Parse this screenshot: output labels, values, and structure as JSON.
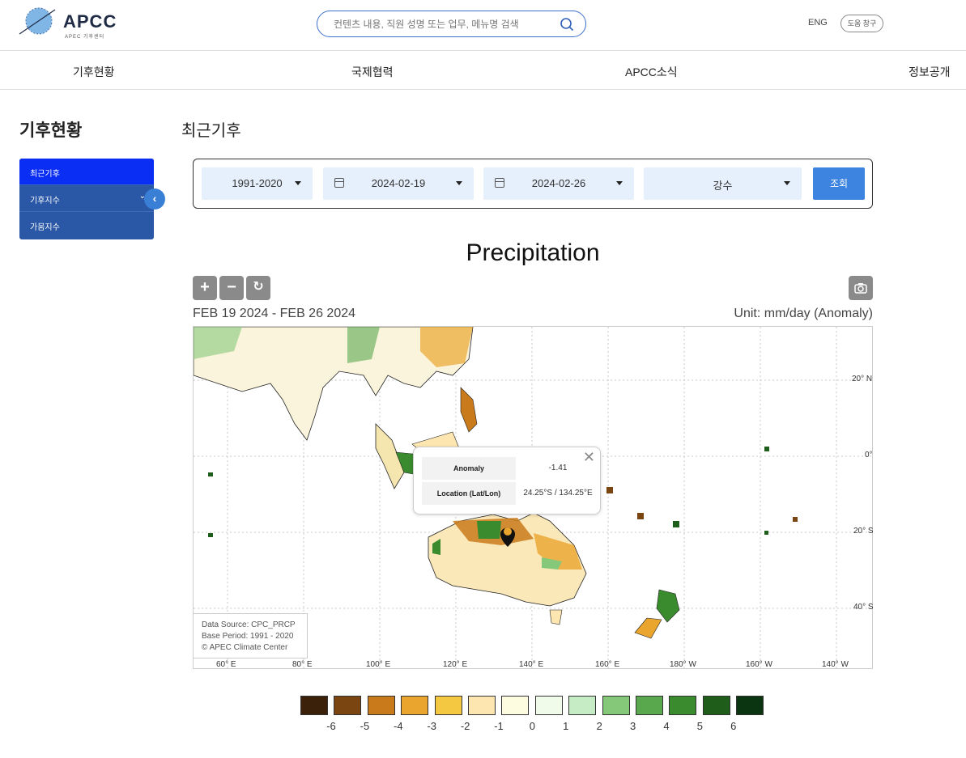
{
  "header": {
    "logo_text": "APCC",
    "logo_sub": "APEC 기후센터",
    "search_placeholder": "컨텐츠 내용, 직원 성명 또는 업무, 메뉴명 검색",
    "lang": "ENG",
    "help": "도움 창구"
  },
  "nav": [
    "기후현황",
    "국제협력",
    "APCC소식",
    "정보공개"
  ],
  "sidebar": {
    "title": "기후현황",
    "items": [
      "최근기후",
      "기후지수",
      "가뭄지수"
    ]
  },
  "page_title": "최근기후",
  "filters": {
    "period": "1991-2020",
    "start_date": "2024-02-19",
    "end_date": "2024-02-26",
    "variable": "강수",
    "submit": "조회"
  },
  "map": {
    "title": "Precipitation",
    "date_range": "FEB 19 2024 - FEB 26 2024",
    "unit": "Unit: mm/day (Anomaly)",
    "popup": {
      "anomaly_label": "Anomaly",
      "anomaly_value": "-1.41",
      "location_label": "Location (Lat/Lon)",
      "location_value": "24.25°S / 134.25°E"
    },
    "credits": [
      "Data Source: CPC_PRCP",
      "Base Period: 1991 - 2020",
      "© APEC Climate Center"
    ],
    "lat_labels": [
      "20° N",
      "0°",
      "20° S",
      "40° S"
    ],
    "lon_labels": [
      "60° E",
      "80° E",
      "100° E",
      "120° E",
      "140° E",
      "160° E",
      "180° W",
      "160° W",
      "140° W"
    ],
    "legend": {
      "colors": [
        "#3b200a",
        "#7a4510",
        "#c97a1a",
        "#eaa52e",
        "#f5c842",
        "#fde6b0",
        "#fefce0",
        "#f0fbea",
        "#c6ecc6",
        "#86c87a",
        "#5aa84e",
        "#3a8a2e",
        "#1e5e1a",
        "#0b3410"
      ],
      "labels": [
        "-6",
        "-5",
        "-4",
        "-3",
        "-2",
        "-1",
        "0",
        "1",
        "2",
        "3",
        "4",
        "5",
        "6"
      ]
    }
  }
}
